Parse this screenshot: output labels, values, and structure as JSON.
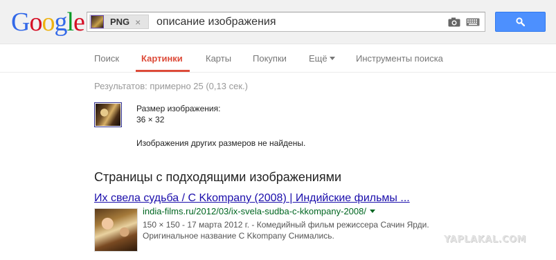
{
  "logo": {
    "text": "Google",
    "letters": [
      "G",
      "o",
      "o",
      "g",
      "l",
      "e"
    ]
  },
  "search": {
    "chip_label": "PNG",
    "chip_close": "×",
    "query": "описание изображения",
    "camera_icon": "camera-icon",
    "keyboard_icon": "keyboard-icon",
    "button_icon": "search-icon"
  },
  "nav": {
    "items": [
      {
        "label": "Поиск"
      },
      {
        "label": "Картинки",
        "active": true
      },
      {
        "label": "Карты"
      },
      {
        "label": "Покупки"
      },
      {
        "label": "Ещё"
      },
      {
        "label": "Инструменты поиска"
      }
    ]
  },
  "stats": "Результатов: примерно 25 (0,13 сек.)",
  "image_info": {
    "size_label": "Размер изображения:",
    "size_value": "36 × 32",
    "no_other_sizes": "Изображения других размеров не найдены."
  },
  "pages_section": {
    "title": "Страницы с подходящими изображениями",
    "results": [
      {
        "title": "Их свела судьба / С Kkompany (2008) | Индийские фильмы ...",
        "url": "india-films.ru/2012/03/ix-svela-sudba-c-kkompany-2008/",
        "snippet_line1": "150 × 150 - 17 марта 2012 г. - Комедийный фильм режиссера Сачин Ярди.",
        "snippet_line2": "Оригинальное название С Kkompany Снимались."
      }
    ]
  },
  "watermark": "YAPLAKAL.COM",
  "colors": {
    "accent": "#dd4b39",
    "link": "#1a0dab",
    "url": "#006621",
    "search_button": "#4d90fe"
  }
}
